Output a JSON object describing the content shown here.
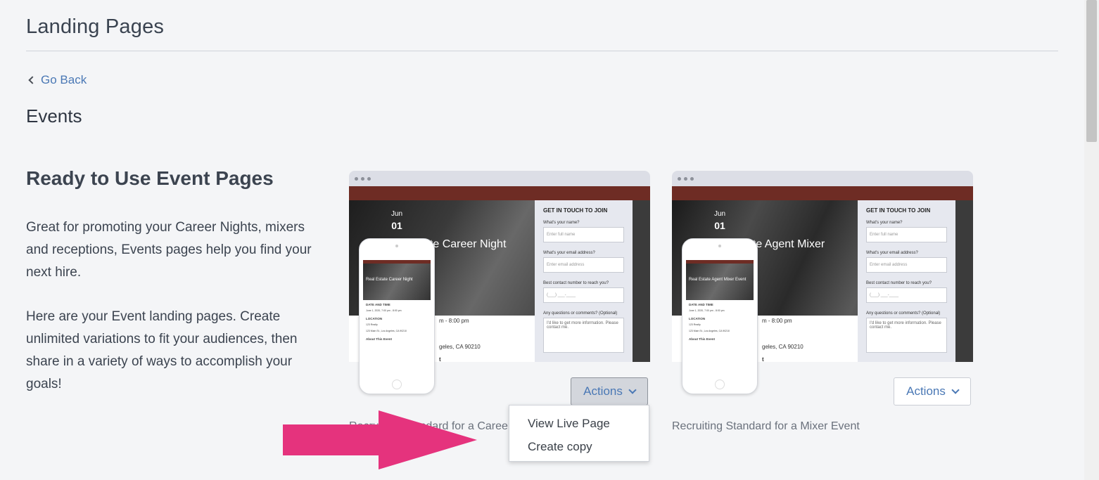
{
  "header": {
    "title": "Landing Pages"
  },
  "nav": {
    "go_back": "Go Back"
  },
  "section": {
    "title": "Events"
  },
  "intro": {
    "heading": "Ready to Use Event Pages",
    "p1": "Great for promoting your Career Nights, mixers and receptions, Events pages help you find your next hire.",
    "p2": "Here are your Event landing pages. Create unlimited variations to fit your audiences, then share in a variety of ways to accomplish your goals!"
  },
  "cards": [
    {
      "hero_month": "Jun",
      "hero_day": "01",
      "hero_title": "ate Career Night",
      "phone_title": "Real Estate Career Night",
      "below_time": "m - 8:00 pm",
      "below_addr": "geles, CA 90210",
      "below_t": "t",
      "form": {
        "heading": "GET IN TOUCH TO JOIN",
        "name_label": "What's your name?",
        "name_placeholder": "Enter full name",
        "email_label": "What's your email address?",
        "email_placeholder": "Enter email address",
        "phone_label": "Best contact number to reach you?",
        "phone_placeholder": "(___) ___-____",
        "comments_label": "Any questions or comments? (Optional)",
        "comments_value": "I'd like to get more information. Please contact me."
      },
      "actions_label": "Actions",
      "caption": "Recruiting Standard for a Career Night Event"
    },
    {
      "hero_month": "Jun",
      "hero_day": "01",
      "hero_title": "ate Agent Mixer",
      "phone_title": "Real Estate Agent Mixer Event",
      "below_time": "m - 8:00 pm",
      "below_addr": "geles, CA 90210",
      "below_t": "t",
      "form": {
        "heading": "GET IN TOUCH TO JOIN",
        "name_label": "What's your name?",
        "name_placeholder": "Enter full name",
        "email_label": "What's your email address?",
        "email_placeholder": "Enter email address",
        "phone_label": "Best contact number to reach you?",
        "phone_placeholder": "(___) ___-____",
        "comments_label": "Any questions or comments? (Optional)",
        "comments_value": "I'd like to get more information. Please contact me."
      },
      "actions_label": "Actions",
      "caption": "Recruiting Standard for a Mixer Event"
    }
  ],
  "phone_preview": {
    "date_label": "DATE AND TIME",
    "date_value": "June 1, 2020, 7:00 pm - 8:00 pm",
    "location_label": "LOCATION",
    "location_value": "123 Realty",
    "address_value": "123 Main St., Los Angeles, CA 90210",
    "about_label": "About This Event"
  },
  "dropdown": {
    "items": [
      "View Live Page",
      "Create copy"
    ]
  },
  "colors": {
    "accent": "#4a78b5",
    "brand_strip": "#6e2c24",
    "highlight_arrow": "#e5337d"
  }
}
